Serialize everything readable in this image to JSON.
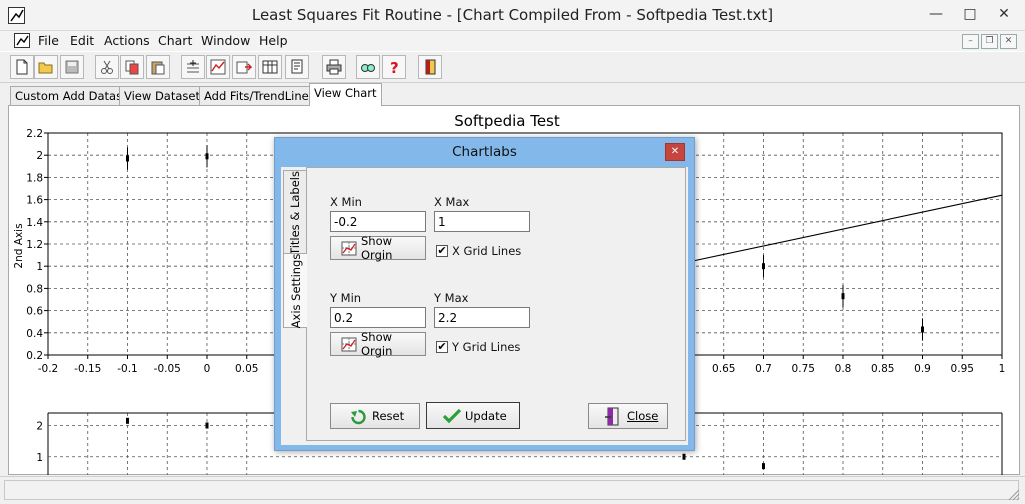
{
  "window": {
    "title": "Least Squares Fit Routine - [Chart Compiled From - Softpedia Test.txt]",
    "min_glyph": "—",
    "max_glyph": "□",
    "close_glyph": "✕"
  },
  "menu": [
    "File",
    "Edit",
    "Actions",
    "Chart",
    "Window",
    "Help"
  ],
  "mdi": {
    "min": "–",
    "restore": "❐",
    "close": "✕"
  },
  "toolbar": {
    "buttons": [
      "new-file-icon",
      "open-folder-icon",
      "save-icon",
      "cut-icon",
      "copy-icon",
      "paste-icon",
      "add-data-icon",
      "line-chart-icon",
      "export-chart-icon",
      "table-icon",
      "print-preview-icon",
      "print-icon",
      "find-icon",
      "help-icon",
      "exit-icon"
    ]
  },
  "tabs": [
    "Custom Add Dataset",
    "View Datasets",
    "Add Fits/TrendLines",
    "View Chart"
  ],
  "colors": {
    "dialog_frame": "#83b8ea",
    "close_red": "#c7453f"
  },
  "chart_data": [
    {
      "type": "scatter",
      "title": "Softpedia Test",
      "ylabel": "2nd Axis",
      "xlabel": "",
      "xlim": [
        -0.2,
        1
      ],
      "ylim": [
        0.2,
        2.2
      ],
      "x_ticks": [
        "-0.2",
        "-0.15",
        "-0.1",
        "-0.05",
        "0",
        "0.05",
        "0.65",
        "0.7",
        "0.75",
        "0.8",
        "0.85",
        "0.9",
        "0.95",
        "1"
      ],
      "y_ticks": [
        "0.2",
        "0.4",
        "0.6",
        "0.8",
        "1",
        "1.2",
        "1.4",
        "1.6",
        "1.8",
        "2",
        "2.2"
      ],
      "grid": true,
      "points": [
        {
          "x": -0.1,
          "y": 1.97,
          "err": 0.1
        },
        {
          "x": 0,
          "y": 1.99,
          "err": 0.1
        },
        {
          "x": 0.7,
          "y": 1.0,
          "err": 0.1
        },
        {
          "x": 0.8,
          "y": 0.73,
          "err": 0.1
        },
        {
          "x": 0.9,
          "y": 0.43,
          "err": 0.1
        }
      ],
      "fit_line": [
        [
          0.6,
          1.03
        ],
        [
          1.0,
          1.64
        ]
      ]
    },
    {
      "type": "scatter",
      "title": "",
      "xlim": [
        -0.2,
        1
      ],
      "y_ticks": [
        "1",
        "2"
      ],
      "grid": true,
      "points": [
        {
          "x": -0.1,
          "y": 2.15
        },
        {
          "x": 0,
          "y": 2.0
        },
        {
          "x": 0.6,
          "y": 1.0
        },
        {
          "x": 0.7,
          "y": 0.7
        }
      ]
    }
  ],
  "dialog": {
    "title": "Chartlabs",
    "close_glyph": "✕",
    "tabs": [
      "Titles & Labels",
      "Axis Settings"
    ],
    "x_min_label": "X Min",
    "x_max_label": "X Max",
    "x_min": "-0.2",
    "x_max": "1",
    "y_min_label": "Y Min",
    "y_max_label": "Y Max",
    "y_min": "0.2",
    "y_max": "2.2",
    "show_origin": "Show Orgin",
    "x_grid": "X Grid Lines",
    "y_grid": "Y Grid Lines",
    "x_grid_checked": true,
    "y_grid_checked": true,
    "check_glyph": "✔",
    "reset": "Reset",
    "update": "Update",
    "close": "Close"
  }
}
